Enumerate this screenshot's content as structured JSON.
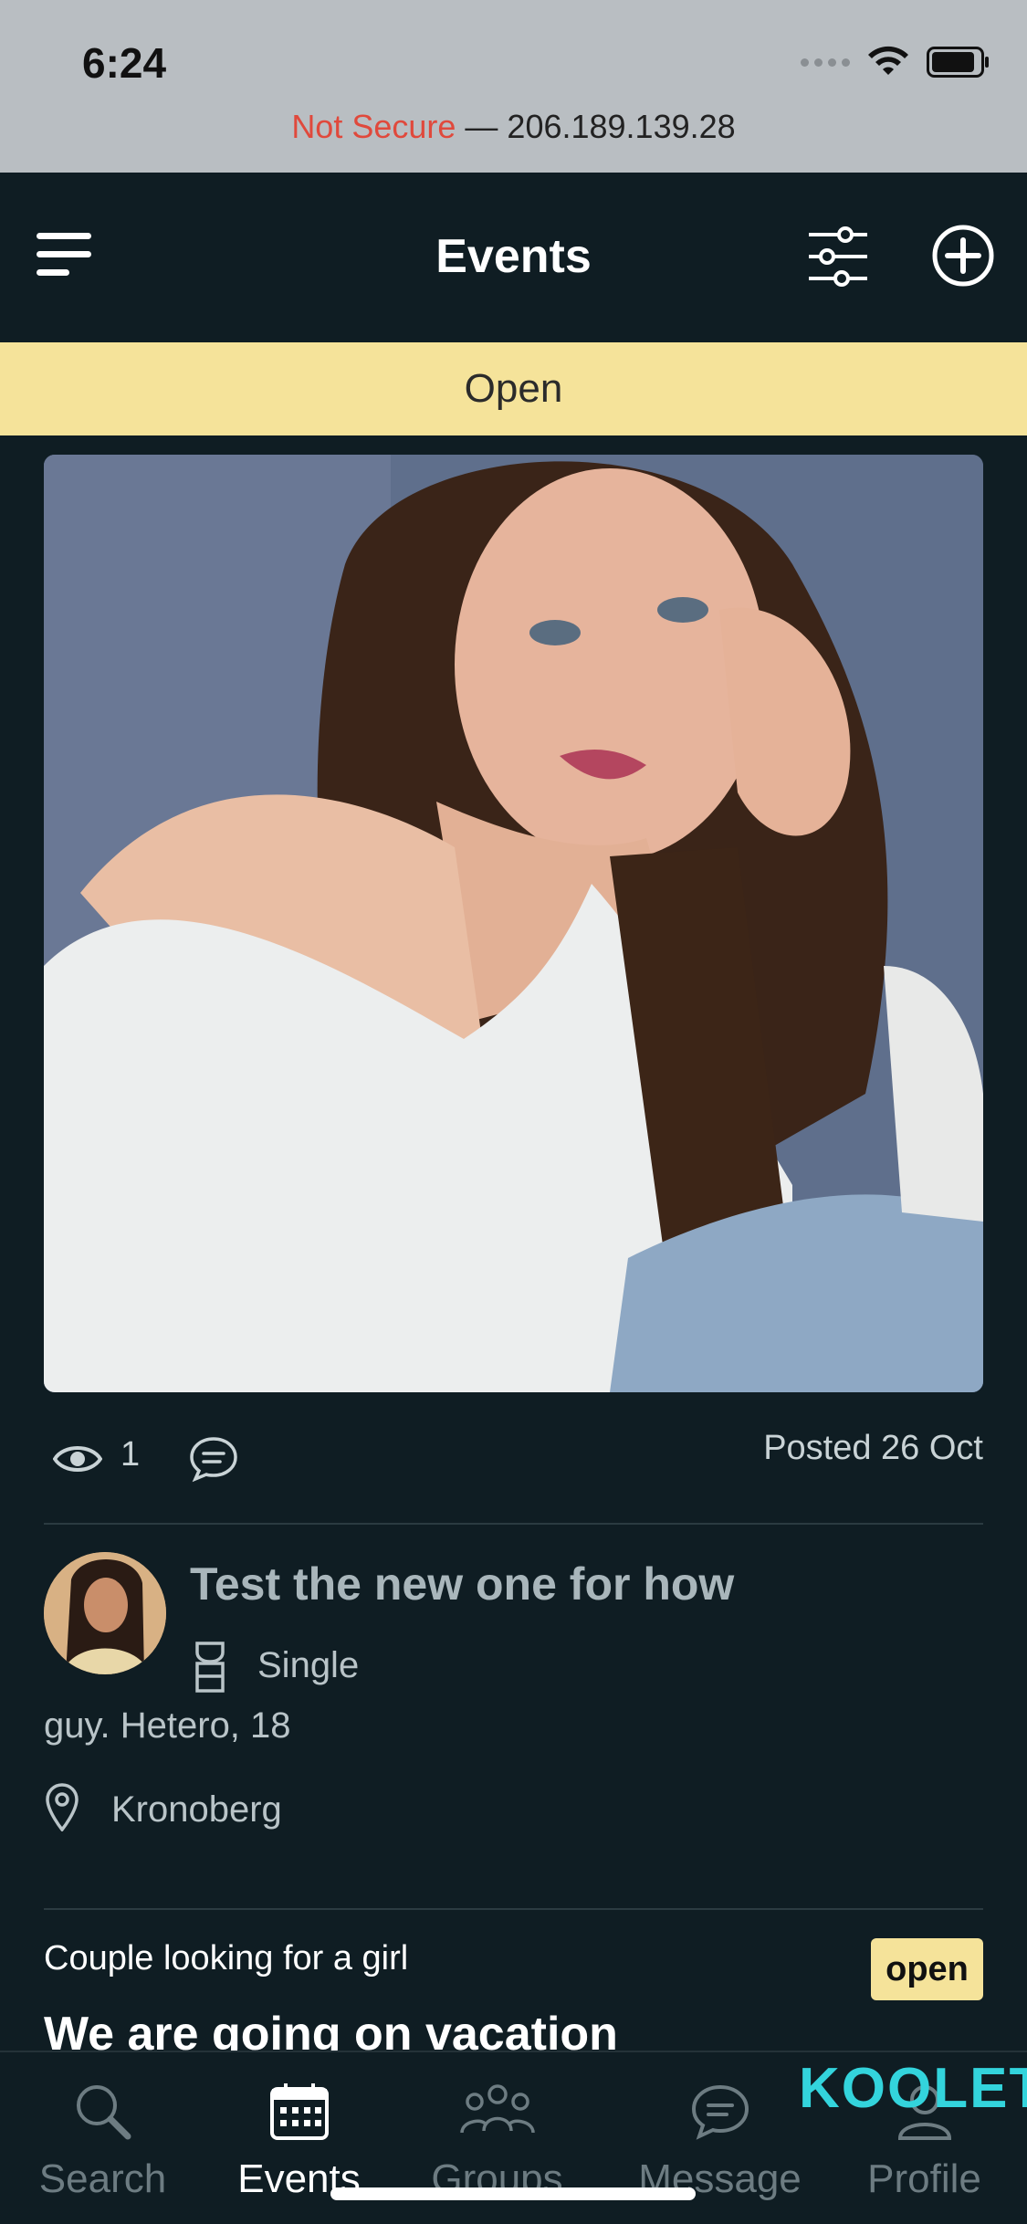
{
  "status_bar": {
    "time": "6:24",
    "url_insecure_label": "Not Secure",
    "url_separator": " — ",
    "url_host": "206.189.139.28"
  },
  "navbar": {
    "title": "Events",
    "icons": [
      "menu-icon",
      "filter-sliders-icon",
      "add-circle-icon"
    ]
  },
  "filter_banner": {
    "label": "Open"
  },
  "event_post": {
    "views": "1",
    "posted": "Posted 26 Oct",
    "title": "Test the new one for how",
    "relationship_status": "Single",
    "description": "guy. Hetero, 18",
    "location": "Kronoberg"
  },
  "next_post": {
    "subtitle": "Couple looking for a girl",
    "badge": "open",
    "title": "We are going on vacation"
  },
  "tabs": [
    {
      "label": "Search",
      "icon": "search-icon",
      "active": false
    },
    {
      "label": "Events",
      "icon": "calendar-icon",
      "active": true
    },
    {
      "label": "Groups",
      "icon": "groups-icon",
      "active": false
    },
    {
      "label": "Message",
      "icon": "message-icon",
      "active": false
    },
    {
      "label": "Profile",
      "icon": "profile-icon",
      "active": false
    }
  ],
  "watermark": "KOOLET",
  "colors": {
    "background": "#0f1d23",
    "banner": "#f5e39a",
    "insecure": "#e0493c",
    "watermark": "#33d4dc"
  }
}
